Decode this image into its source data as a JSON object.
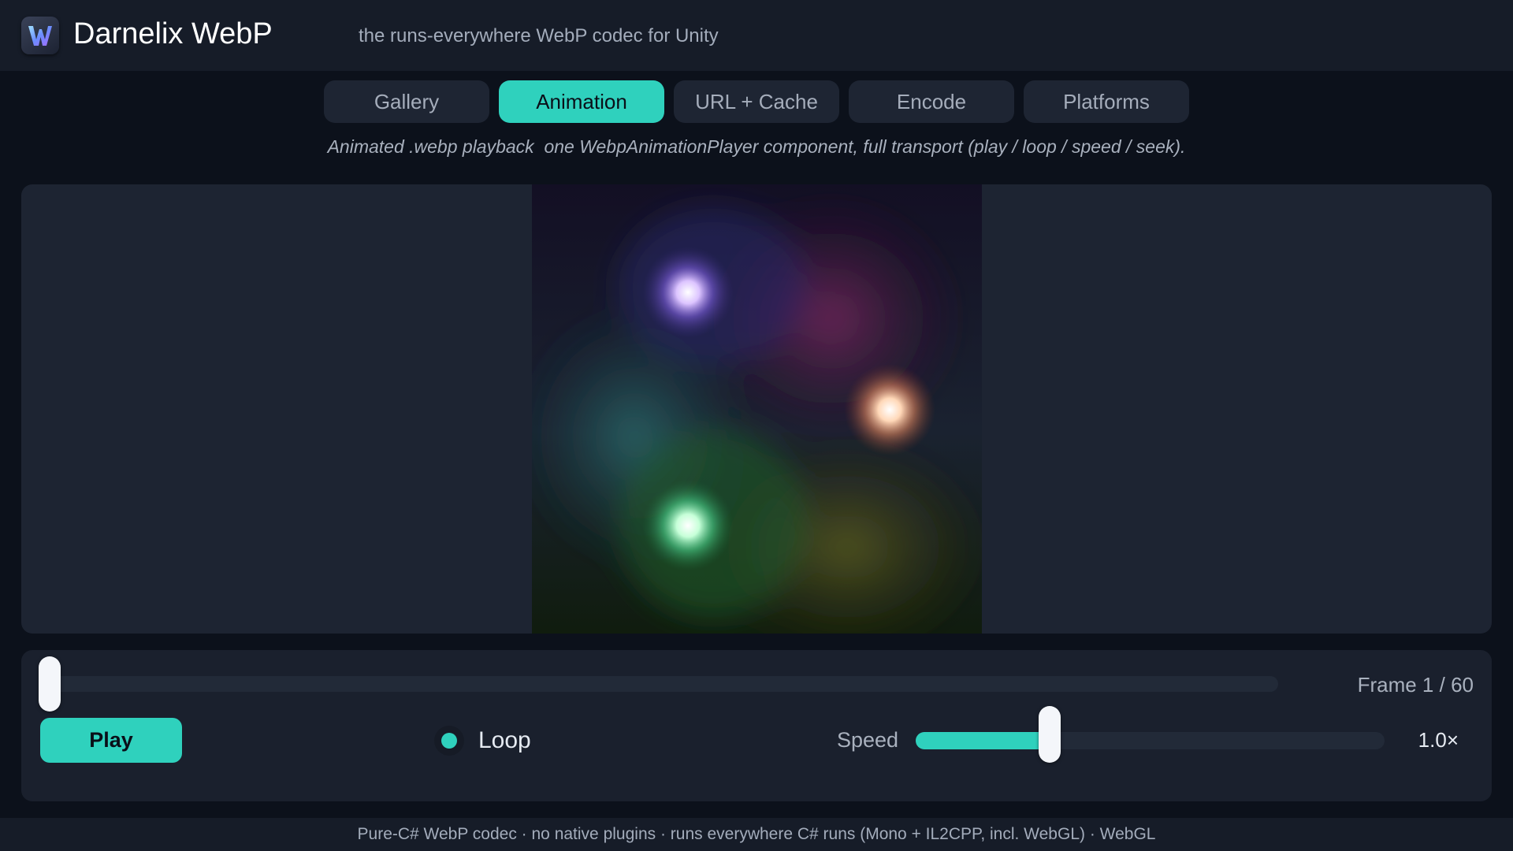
{
  "header": {
    "title": "Darnelix WebP",
    "tagline": "the runs-everywhere WebP codec for Unity",
    "logo_letter": "W",
    "logo_icon": "webp-logo-icon"
  },
  "tabs": [
    {
      "label": "Gallery",
      "active": false
    },
    {
      "label": "Animation",
      "active": true
    },
    {
      "label": "URL + Cache",
      "active": false
    },
    {
      "label": "Encode",
      "active": false
    },
    {
      "label": "Platforms",
      "active": false
    }
  ],
  "description": "Animated .webp playback  one WebpAnimationPlayer component, full transport (play / loop / speed / seek).",
  "viewer": {
    "animation": {
      "blobs": [
        "violet",
        "peach",
        "green"
      ]
    }
  },
  "controls": {
    "seek_fraction": 0.0,
    "frame_label": "Frame 1 / 60",
    "play_label": "Play",
    "loop_label": "Loop",
    "loop_enabled": true,
    "speed_label": "Speed",
    "speed_fraction": 0.285,
    "speed_value": "1.0×"
  },
  "footer": {
    "text": "Pure-C# WebP codec · no native plugins · runs everywhere C# runs (Mono + IL2CPP, incl. WebGL) · WebGL"
  },
  "colors": {
    "accent": "#2fd1bd",
    "background": "#0c111b",
    "panel": "#1d2432",
    "header": "#161c28"
  }
}
